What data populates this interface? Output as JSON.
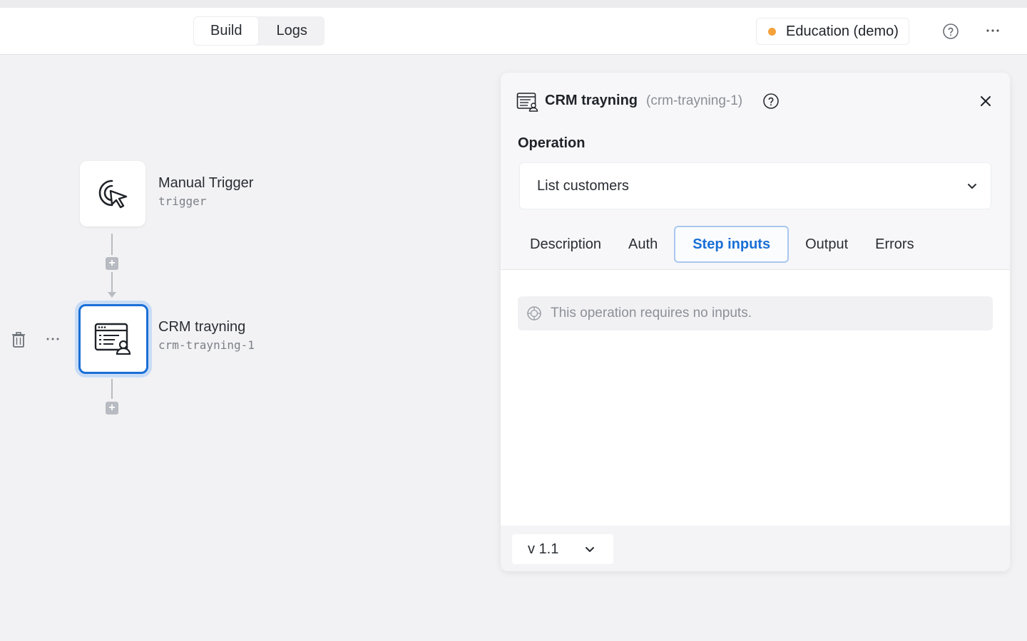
{
  "header": {
    "tabs": [
      {
        "label": "Build",
        "active": true
      },
      {
        "label": "Logs",
        "active": false
      }
    ],
    "environment": {
      "label": "Education (demo)",
      "status_color": "#f5a23b"
    }
  },
  "canvas": {
    "nodes": [
      {
        "title": "Manual Trigger",
        "subtitle": "trigger",
        "icon": "cursor-click-icon"
      },
      {
        "title": "CRM trayning",
        "subtitle": "crm-trayning-1",
        "icon": "crm-icon",
        "selected": true
      }
    ]
  },
  "panel": {
    "title": "CRM trayning",
    "slug": "(crm-trayning-1)",
    "operation_label": "Operation",
    "operation_value": "List customers",
    "tabs": [
      {
        "label": "Description"
      },
      {
        "label": "Auth"
      },
      {
        "label": "Step inputs",
        "active": true
      },
      {
        "label": "Output"
      },
      {
        "label": "Errors"
      }
    ],
    "notice": "This operation requires no inputs.",
    "version": "v 1.1"
  },
  "colors": {
    "accent": "#1a6fd6",
    "selection_ring": "#c9dcf6"
  }
}
